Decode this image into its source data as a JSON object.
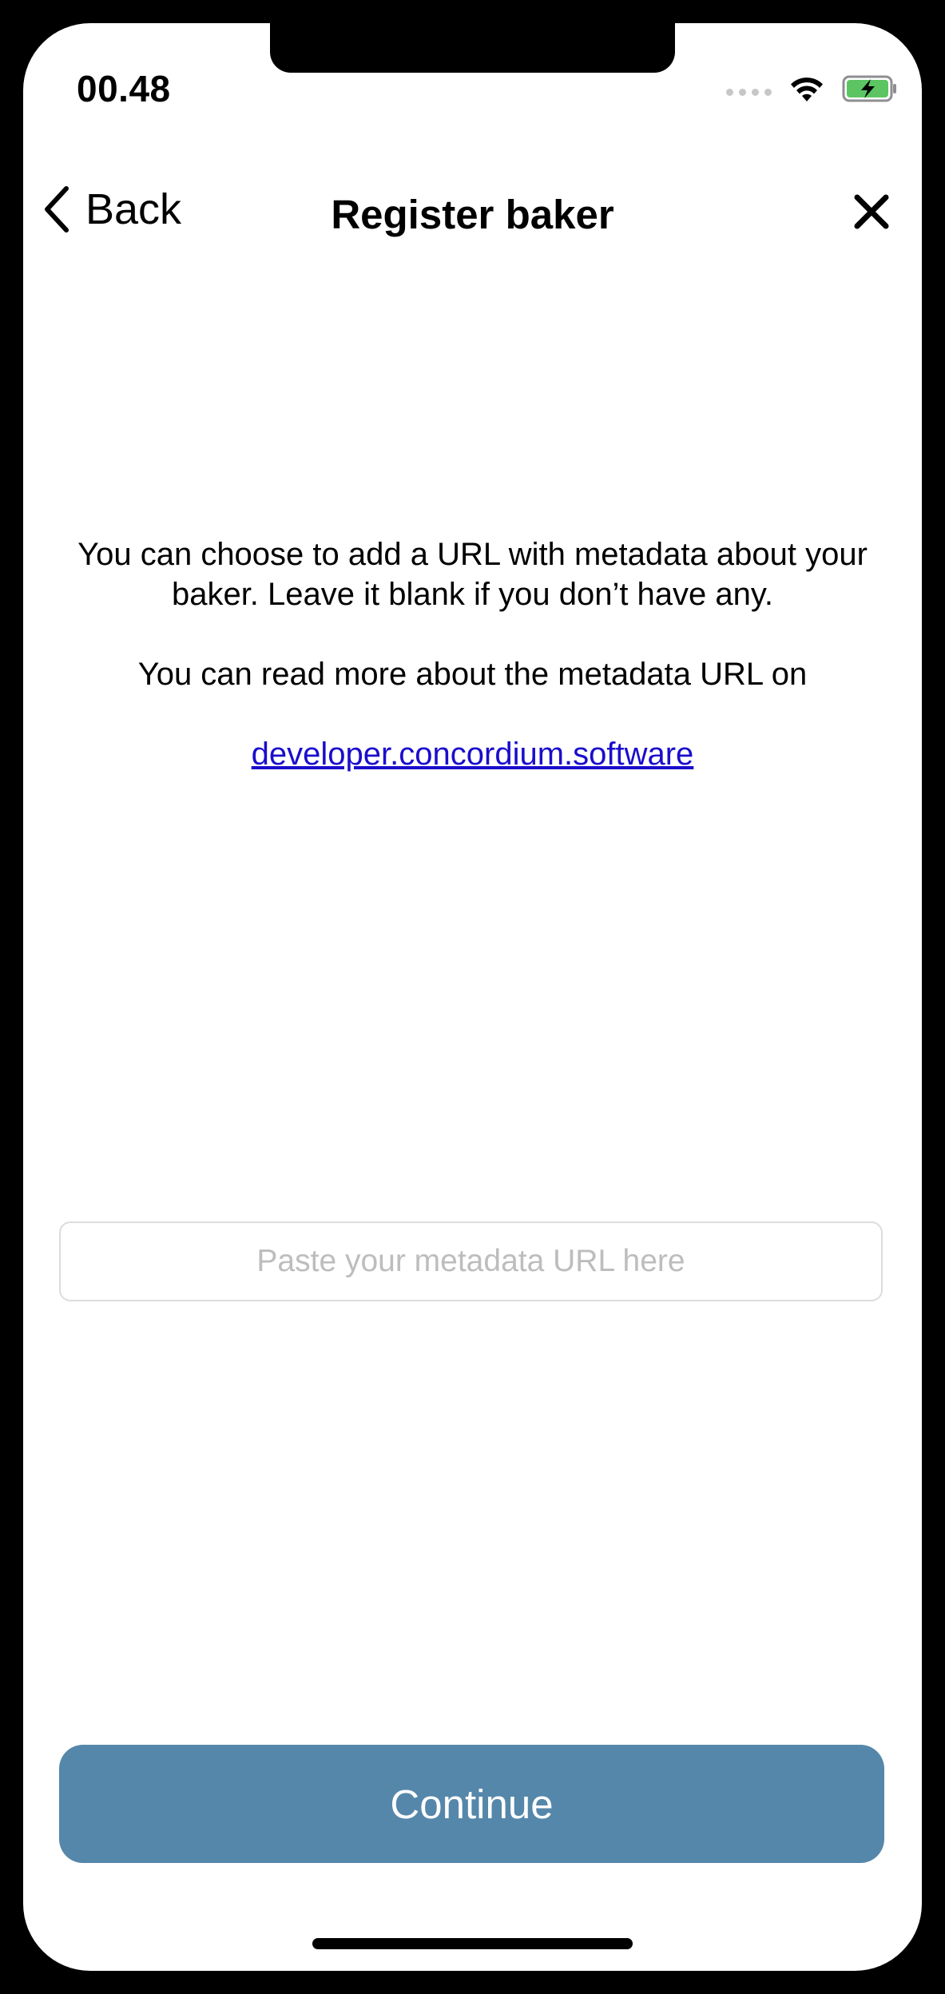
{
  "status_bar": {
    "time": "00.48",
    "icons": [
      "cellular-signal-icon",
      "wifi-icon",
      "battery-charging-icon"
    ]
  },
  "nav": {
    "back_label": "Back",
    "title": "Register baker",
    "close_icon": "close-icon"
  },
  "info": {
    "paragraph_1": "You can choose to add a URL with metadata about your baker. Leave it blank if you don’t have any.",
    "paragraph_2": "You can read more about the metadata URL on",
    "link_text": "developer.concordium.software"
  },
  "metadata_input": {
    "value": "",
    "placeholder": "Paste your metadata URL here"
  },
  "continue_button": {
    "label": "Continue"
  },
  "colors": {
    "continue_button": "#5587aa",
    "link": "#1a0dcc",
    "battery_fill": "#5cc461"
  }
}
